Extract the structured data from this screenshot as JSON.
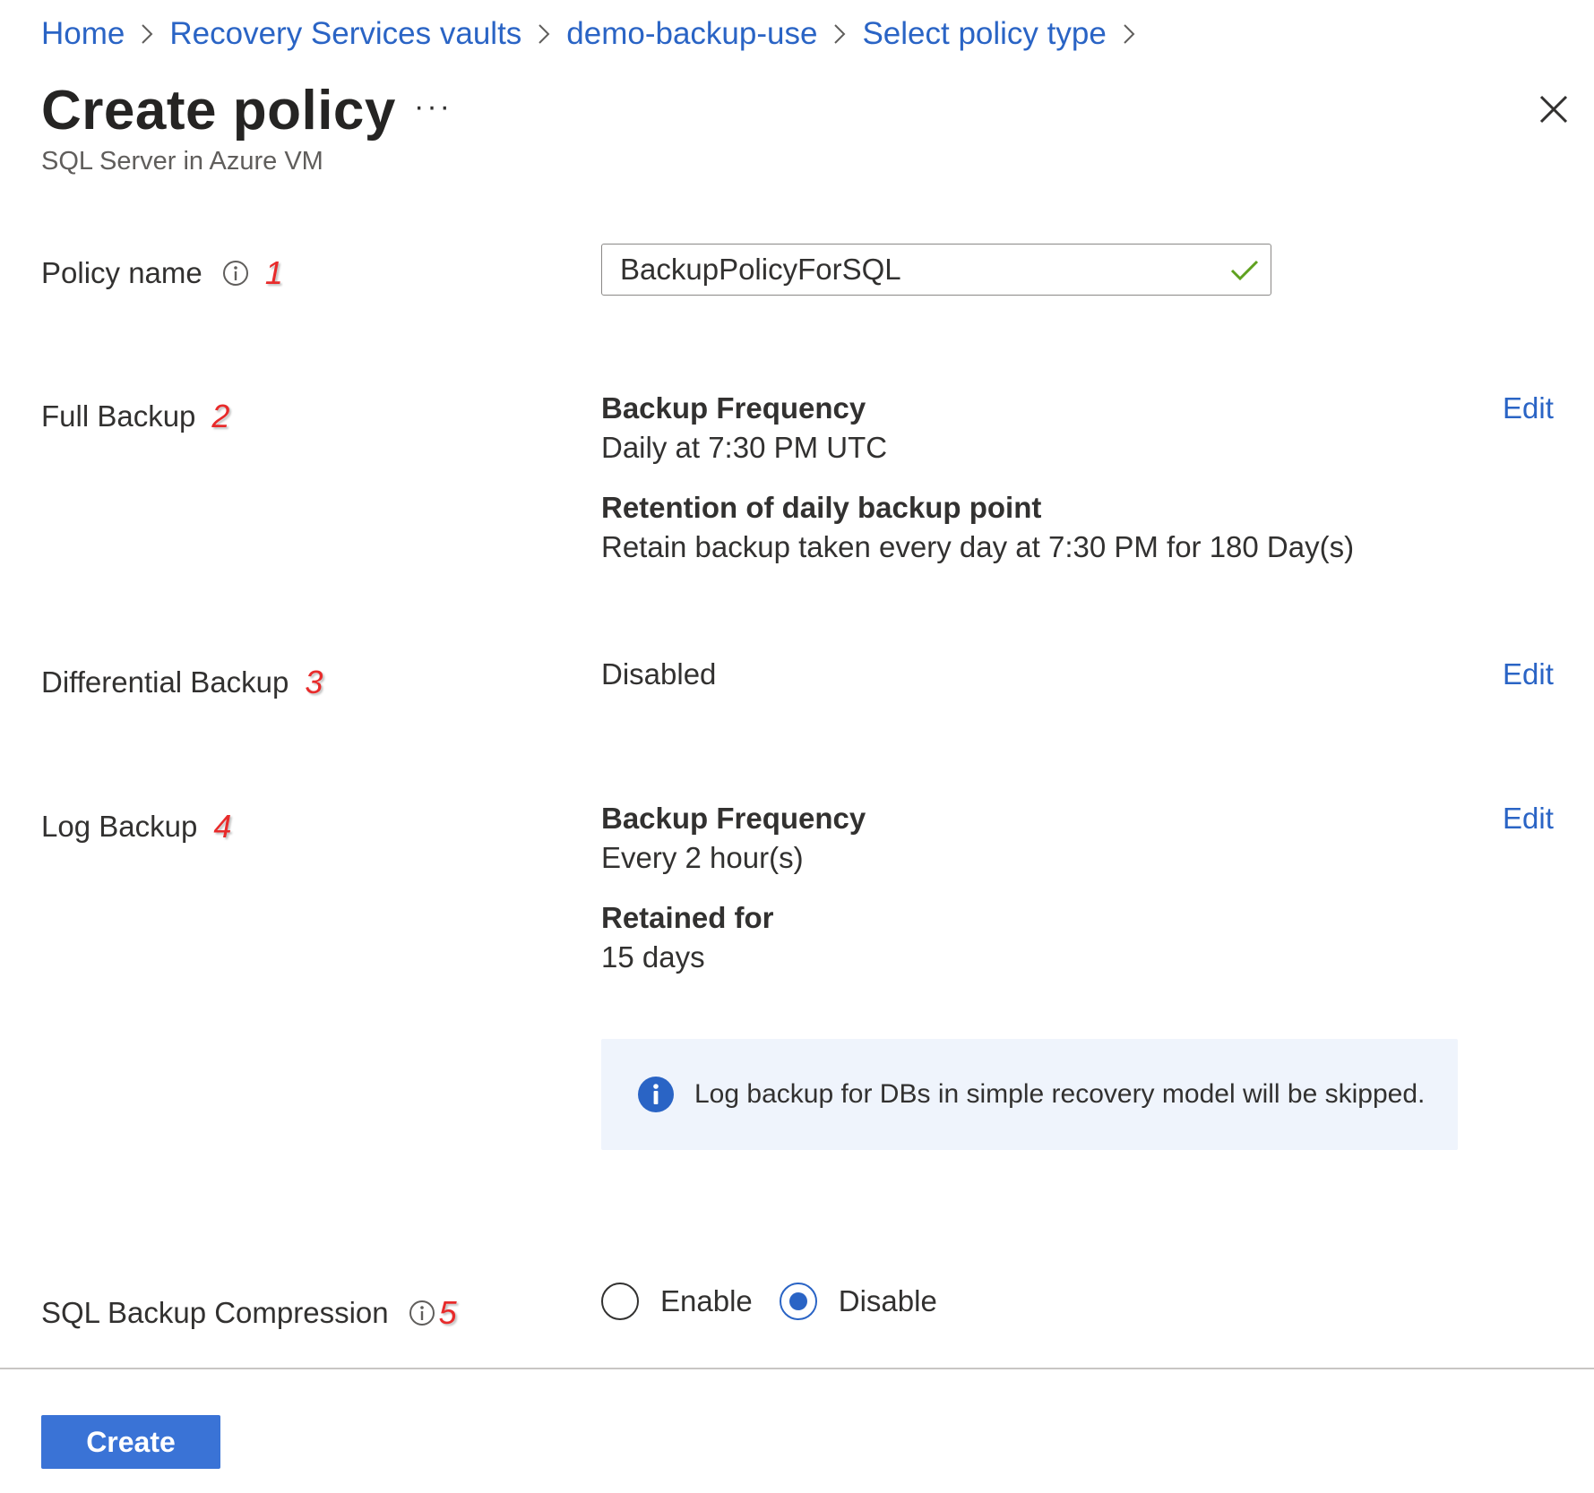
{
  "breadcrumb": [
    "Home",
    "Recovery Services vaults",
    "demo-backup-use",
    "Select policy type"
  ],
  "header": {
    "title": "Create policy",
    "more": "···",
    "subtitle": "SQL Server in Azure VM"
  },
  "policy_name": {
    "label": "Policy name",
    "marker": "1",
    "value": "BackupPolicyForSQL"
  },
  "full_backup": {
    "label": "Full Backup",
    "marker": "2",
    "frequency_heading": "Backup Frequency",
    "frequency_value": "Daily at 7:30 PM UTC",
    "retention_heading": "Retention of daily backup point",
    "retention_value": "Retain backup taken every day at 7:30 PM for 180 Day(s)",
    "edit": "Edit"
  },
  "differential_backup": {
    "label": "Differential Backup",
    "marker": "3",
    "value": "Disabled",
    "edit": "Edit"
  },
  "log_backup": {
    "label": "Log Backup",
    "marker": "4",
    "frequency_heading": "Backup Frequency",
    "frequency_value": "Every 2 hour(s)",
    "retained_heading": "Retained for",
    "retained_value": "15 days",
    "edit": "Edit",
    "info": "Log backup for DBs in simple recovery model will be skipped."
  },
  "compression": {
    "label": "SQL Backup Compression",
    "marker": "5",
    "options": [
      "Enable",
      "Disable"
    ],
    "selected": "Disable"
  },
  "footer": {
    "create": "Create"
  },
  "colors": {
    "link": "#2a64c5",
    "accent": "#3a73d6",
    "success": "#5fa11f",
    "marker": "#e82b2b",
    "banner_bg": "#eff4fc"
  }
}
